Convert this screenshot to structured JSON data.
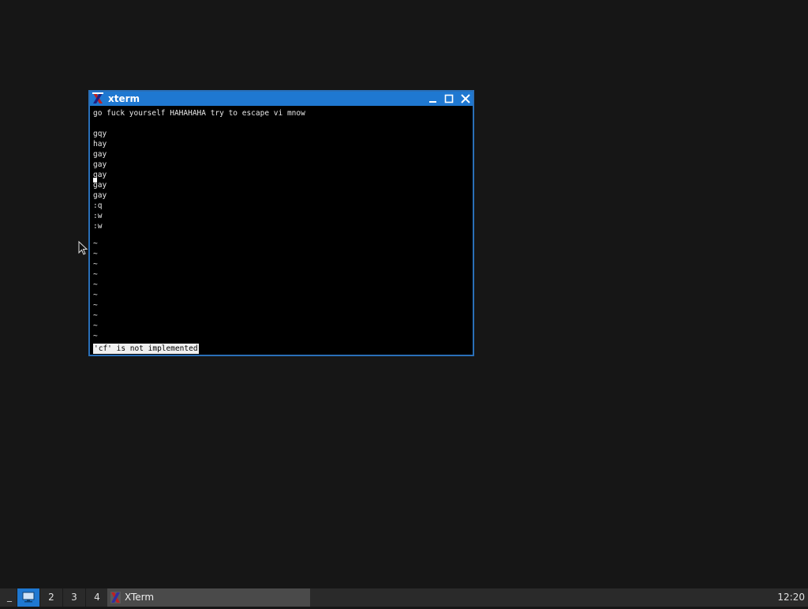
{
  "window": {
    "title": "xterm",
    "icon": "xterm-x-icon",
    "buttons": [
      "minimize-icon",
      "maximize-icon",
      "close-icon"
    ]
  },
  "terminal": {
    "lines": [
      "go fuck yourself HAHAHAHA try to escape vi mnow",
      "",
      "gqy",
      "hay",
      "gay",
      "gay",
      "gay",
      "gay",
      "gay",
      ":q",
      ":w",
      ":w",
      "",
      "~",
      "~",
      "~",
      "~",
      "~",
      "~",
      "~",
      "~",
      "~",
      "~"
    ],
    "status": "'cf' is not implemented"
  },
  "taskbar": {
    "show_desktop": "_",
    "workspaces": [
      "",
      "2",
      "3",
      "4"
    ],
    "active_workspace": 1,
    "task_label": "XTerm",
    "clock": "12:20"
  },
  "colors": {
    "desktop": "#161616",
    "titlebar": "#1f78d1",
    "taskbar": "#2a2a2a"
  }
}
